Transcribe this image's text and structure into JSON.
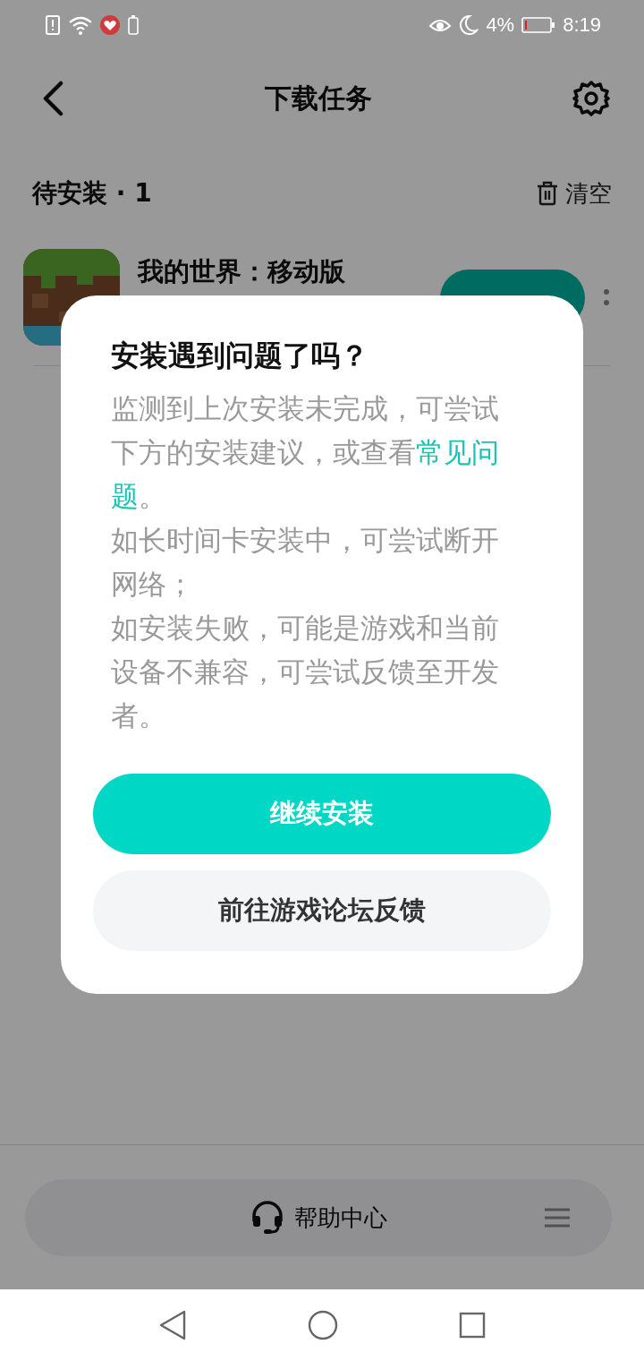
{
  "status_bar": {
    "battery_percent": "4%",
    "time": "8:19"
  },
  "header": {
    "title": "下载任务"
  },
  "section": {
    "title": "待安装 · 1",
    "clear_label": "清空"
  },
  "tasks": [
    {
      "name": "我的世界：移动版"
    }
  ],
  "dialog": {
    "title": "安装遇到问题了吗？",
    "intro": {
      "before": "监测到上次安装未完成，可尝试下方的安装建议，或查看",
      "link_parts": [
        "常见问",
        "题"
      ],
      "after": "。"
    },
    "lines": [
      "如长时间卡安装中，可尝试断开网络；",
      "如安装失败，可能是游戏和当前设备不兼容，可尝试反馈至开发者。"
    ],
    "primary_button": "继续安装",
    "secondary_button": "前往游戏论坛反馈"
  },
  "help_bar": {
    "label": "帮助中心"
  }
}
